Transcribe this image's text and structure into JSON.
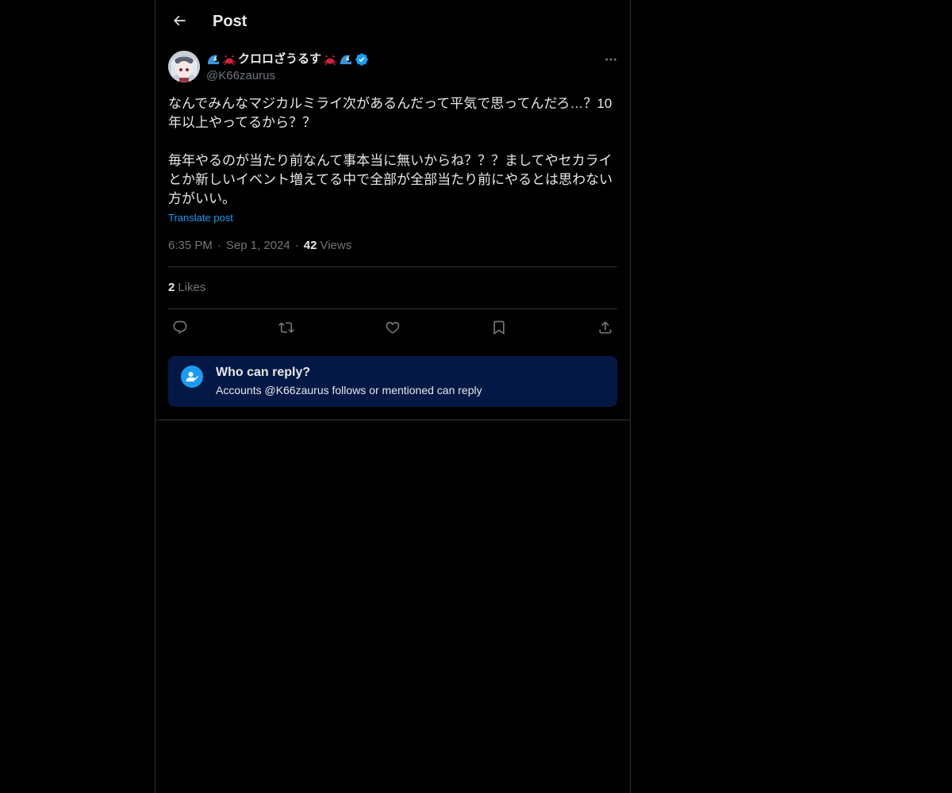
{
  "header": {
    "title": "Post",
    "back_icon": "arrow-left-icon"
  },
  "author": {
    "display_name": "クロロざうるす",
    "handle": "@K66zaurus",
    "verified": true,
    "badge_color": "#1d9bf0"
  },
  "post": {
    "text": "なんでみんなマジカルミライ次があるんだって平気で思ってんだろ…？10年以上やってるから？？\n\n毎年やるのが当たり前なんて事本当に無いからね？？？ましてやセカライとか新しいイベント増えてる中で全部が全部当たり前にやるとは思わない方がいい。",
    "translate_label": "Translate post",
    "time": "6:35 PM",
    "date": "Sep 1, 2024",
    "separator": "·",
    "views_count": "42",
    "views_label": "Views"
  },
  "engagement": {
    "likes_count": "2",
    "likes_label": "Likes"
  },
  "actions": [
    {
      "name": "reply",
      "icon": "reply-icon"
    },
    {
      "name": "repost",
      "icon": "repost-icon"
    },
    {
      "name": "like",
      "icon": "heart-icon"
    },
    {
      "name": "bookmark",
      "icon": "bookmark-icon"
    },
    {
      "name": "share",
      "icon": "share-icon"
    }
  ],
  "reply_restriction": {
    "title": "Who can reply?",
    "subtitle": "Accounts @K66zaurus follows or mentioned can reply",
    "icon": "person-check-icon"
  },
  "colors": {
    "background": "#000000",
    "text": "#e7e9ea",
    "muted": "#71767b",
    "accent": "#1d9bf0",
    "border": "#2f3336",
    "reply_box": "#031844"
  }
}
